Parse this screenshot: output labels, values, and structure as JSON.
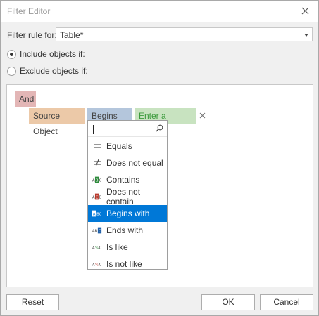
{
  "window": {
    "title": "Filter Editor"
  },
  "filter_rule": {
    "label": "Filter rule for:",
    "value": "Table*"
  },
  "mode": {
    "include_label": "Include objects if:",
    "exclude_label": "Exclude objects if:",
    "selected": "include"
  },
  "tree": {
    "group_label": "And",
    "condition": {
      "field": "Source Object",
      "operator": "Begins with",
      "value_placeholder": "Enter a value..."
    }
  },
  "operator_dropdown": {
    "search_text": "",
    "selected": "Begins with",
    "items": [
      {
        "label": "Equals",
        "icon": "equals-icon"
      },
      {
        "label": "Does not equal",
        "icon": "not-equal-icon"
      },
      {
        "label": "Contains",
        "icon": "contains-icon"
      },
      {
        "label": "Does not contain",
        "icon": "does-not-contain-icon"
      },
      {
        "label": "Begins with",
        "icon": "begins-with-icon"
      },
      {
        "label": "Ends with",
        "icon": "ends-with-icon"
      },
      {
        "label": "Is like",
        "icon": "is-like-icon"
      },
      {
        "label": "Is not like",
        "icon": "is-not-like-icon"
      }
    ]
  },
  "buttons": {
    "reset": "Reset",
    "ok": "OK",
    "cancel": "Cancel"
  }
}
